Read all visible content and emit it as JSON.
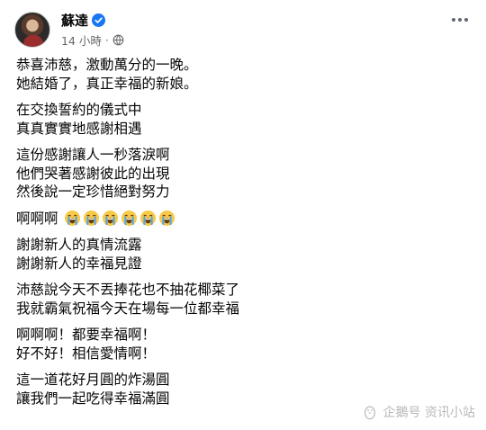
{
  "author": {
    "name": "蘇達"
  },
  "meta": {
    "time": "14 小時",
    "separator": "·"
  },
  "post": {
    "paragraphs": [
      {
        "lines": [
          "恭喜沛慈，激動萬分的一晚。",
          "她結婚了，真正幸福的新娘。"
        ]
      },
      {
        "lines": [
          "在交換誓約的儀式中",
          "真真實實地感謝相遇"
        ]
      },
      {
        "lines": [
          "這份感謝讓人一秒落淚啊",
          "他們哭著感謝彼此的出現",
          "然後說一定珍惜絕對努力"
        ]
      },
      {
        "emoji_line": {
          "text": "啊啊啊",
          "emoji_count": 6
        }
      },
      {
        "lines": [
          "謝謝新人的真情流露",
          "謝謝新人的幸福見證"
        ]
      },
      {
        "lines": [
          "沛慈說今天不丟捧花也不抽花椰菜了",
          "我就霸氣祝福今天在場每一位都幸福"
        ]
      },
      {
        "lines": [
          "啊啊啊！都要幸福啊！",
          "好不好！相信愛情啊！"
        ]
      },
      {
        "lines": [
          "這一道花好月圓的炸湯圓",
          "讓我們一起吃得幸福滿圓"
        ]
      }
    ]
  },
  "watermark": {
    "text": "企鵝号 资讯小站"
  },
  "icons": {
    "verified": "verified-badge-icon",
    "audience": "globe-icon",
    "more": "more-options-icon",
    "emoji": "loudly-crying-face-icon",
    "watermark": "penguin-logo-icon"
  },
  "colors": {
    "verified": "#1877f2",
    "meta": "#65676b",
    "text": "#050505",
    "emoji": "#f7c948"
  }
}
